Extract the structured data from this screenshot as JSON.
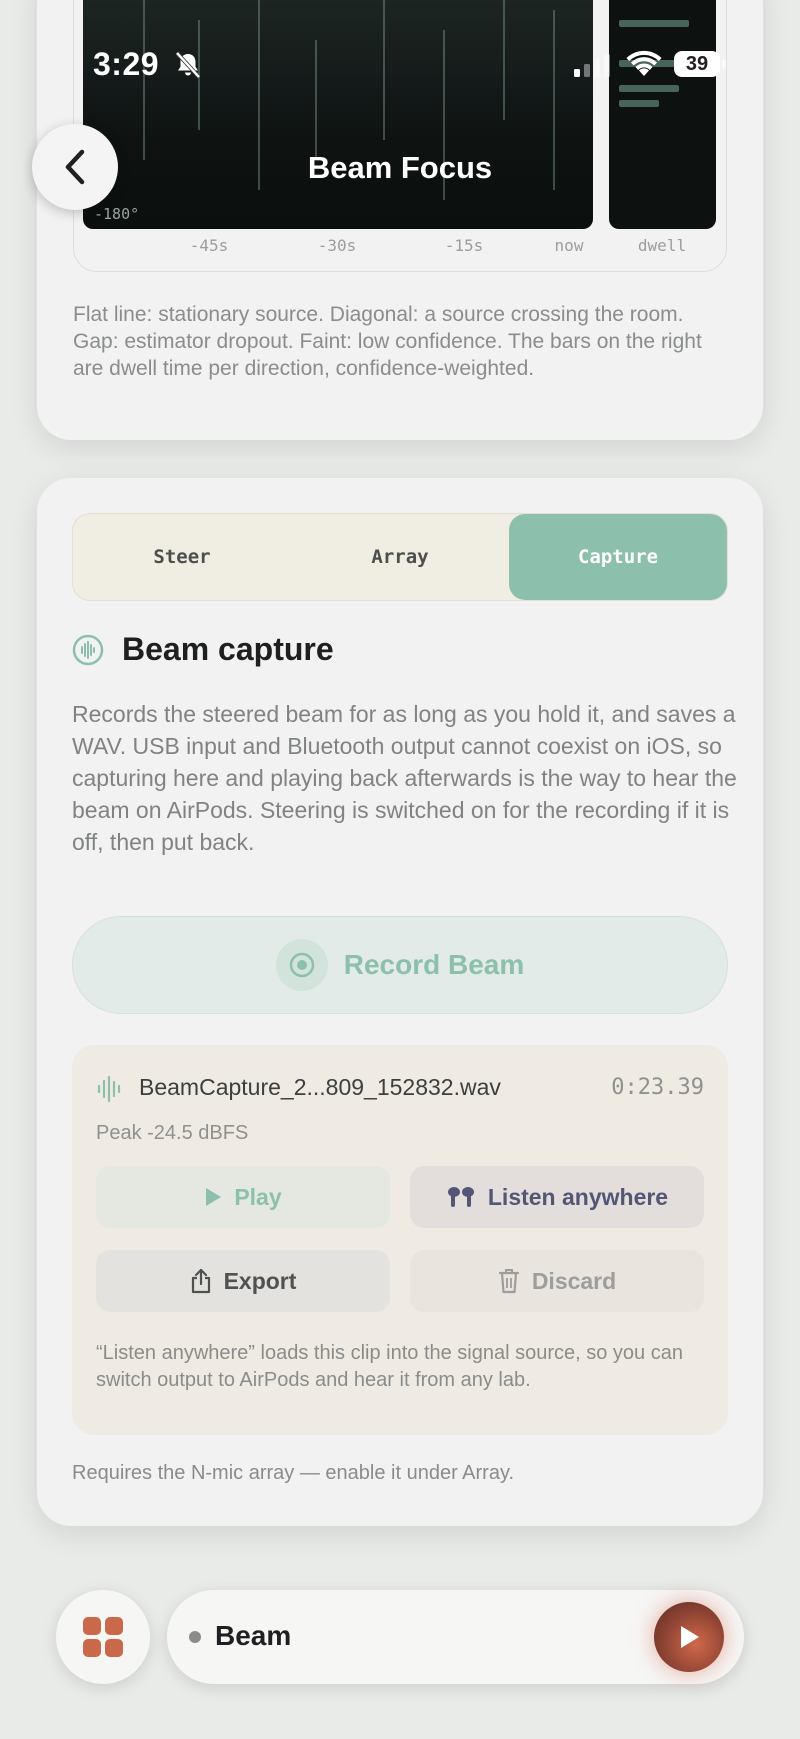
{
  "status_bar": {
    "time": "3:29",
    "battery": "39",
    "icons": [
      "bell-slash-icon",
      "cellular-signal-icon",
      "wifi-icon",
      "battery-icon"
    ]
  },
  "nav": {
    "title": "Beam Focus",
    "back_icon": "chevron-left-icon"
  },
  "history_chart": {
    "y_label": "-180°",
    "x_ticks": [
      "-45s",
      "-30s",
      "-15s",
      "now"
    ],
    "dwell_label": "dwell",
    "caption": "Flat line: stationary source. Diagonal: a source crossing the room. Gap: estimator dropout. Faint: low confidence. The bars on the right are dwell time per direction, confidence-weighted."
  },
  "tabs": [
    {
      "label": "Steer",
      "active": false
    },
    {
      "label": "Array",
      "active": false
    },
    {
      "label": "Capture",
      "active": true
    }
  ],
  "capture": {
    "title": "Beam capture",
    "icon": "waveform-circle-icon",
    "description": "Records the steered beam for as long as you hold it, and saves a WAV. USB input and Bluetooth output cannot coexist on iOS, so capturing here and playing back afterwards is the way to hear the beam on AirPods. Steering is switched on for the recording if it is off, then put back.",
    "record_label": "Record Beam",
    "clip": {
      "filename": "BeamCapture_2...809_152832.wav",
      "duration": "0:23.39",
      "peak": "Peak -24.5 dBFS",
      "play_label": "Play",
      "listen_label": "Listen anywhere",
      "export_label": "Export",
      "discard_label": "Discard",
      "note": "“Listen anywhere” loads this clip into the signal source, so you can switch output to AirPods and hear it from any lab."
    },
    "requirement": "Requires the N-mic array — enable it under Array."
  },
  "bottom_bar": {
    "source_label": "Beam",
    "colors": {
      "accent": "#c9694a",
      "teal": "#8cc0ad"
    }
  }
}
